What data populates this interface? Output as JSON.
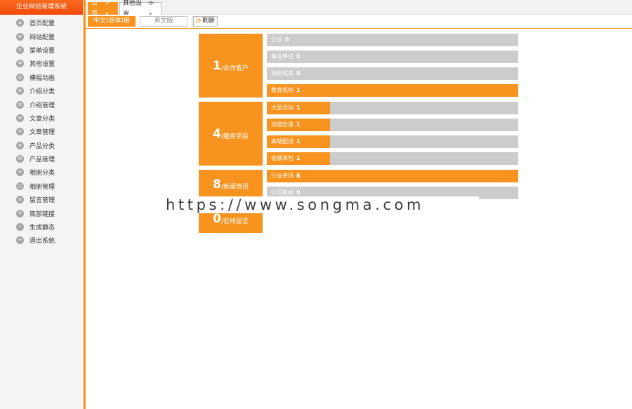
{
  "app": {
    "title": "企业网站管理系统"
  },
  "sidebar": {
    "items": [
      {
        "label": "首页配置",
        "icon": "home-icon"
      },
      {
        "label": "网站配置",
        "icon": "site-icon"
      },
      {
        "label": "菜单设置",
        "icon": "menu-icon"
      },
      {
        "label": "其他设置",
        "icon": "gear-icon"
      },
      {
        "label": "横幅动画",
        "icon": "banner-icon"
      },
      {
        "label": "介绍分类",
        "icon": "category-icon"
      },
      {
        "label": "介绍管理",
        "icon": "intro-icon"
      },
      {
        "label": "文章分类",
        "icon": "article-category-icon"
      },
      {
        "label": "文章管理",
        "icon": "article-icon"
      },
      {
        "label": "产品分类",
        "icon": "product-category-icon"
      },
      {
        "label": "产品管理",
        "icon": "product-icon"
      },
      {
        "label": "相册分类",
        "icon": "album-category-icon"
      },
      {
        "label": "相册管理",
        "icon": "album-icon"
      },
      {
        "label": "留言管理",
        "icon": "message-icon"
      },
      {
        "label": "底部链接",
        "icon": "link-icon"
      },
      {
        "label": "生成静态",
        "icon": "generate-icon"
      },
      {
        "label": "退出系统",
        "icon": "logout-icon"
      }
    ]
  },
  "tabs": [
    {
      "label": "首页",
      "tools": "⟳ x"
    },
    {
      "label": "其他设置",
      "tools": "⟳ x"
    }
  ],
  "toolbar": {
    "lang_cn": "中文(简体)版",
    "lang_en": "英文版",
    "refresh": "刷新"
  },
  "stats": [
    {
      "num": "1",
      "label": "/合作客户",
      "bars": [
        {
          "label": "企业",
          "value": "0",
          "fill": 0
        },
        {
          "label": "事业单位",
          "value": "0",
          "fill": 0
        },
        {
          "label": "政府机关",
          "value": "0",
          "fill": 0
        },
        {
          "label": "教育机构",
          "value": "1",
          "fill": 1.0
        }
      ]
    },
    {
      "num": "4",
      "label": "/服务项目",
      "bars": [
        {
          "label": "大型活动",
          "value": "1",
          "fill": 0.25
        },
        {
          "label": "场馆改造",
          "value": "1",
          "fill": 0.25
        },
        {
          "label": "高端配送",
          "value": "1",
          "fill": 0.25
        },
        {
          "label": "会展承包",
          "value": "1",
          "fill": 0.25
        }
      ]
    },
    {
      "num": "8",
      "label": "/新闻资讯",
      "bars": [
        {
          "label": "行业资讯",
          "value": "8",
          "fill": 1.0
        },
        {
          "label": "公司新闻",
          "value": "0",
          "fill": 0
        }
      ]
    },
    {
      "num": "0",
      "label": "/在线留言",
      "bars": []
    }
  ],
  "watermark": "https://www.songma.com",
  "colors": {
    "accent": "#f7931e",
    "bar_empty": "#cccccc",
    "brand": "#f04a0a"
  }
}
